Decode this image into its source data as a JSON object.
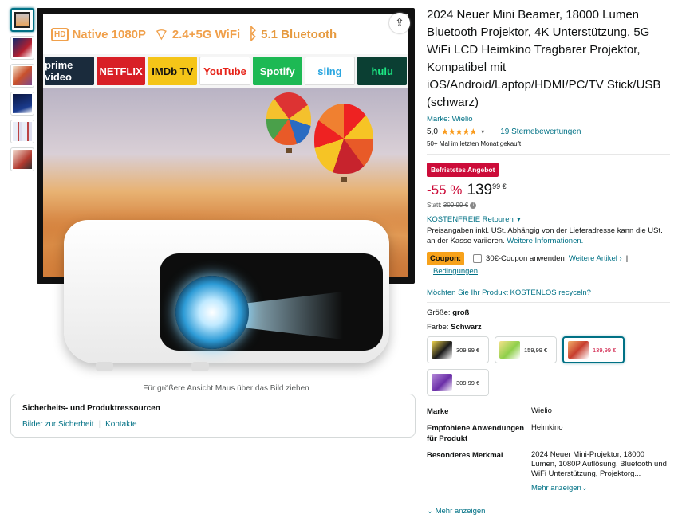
{
  "gallery": {
    "thumbnails": [
      {
        "name": "thumbnail-1",
        "selected": true
      },
      {
        "name": "thumbnail-2",
        "selected": false
      },
      {
        "name": "thumbnail-3",
        "selected": false
      },
      {
        "name": "thumbnail-4",
        "selected": false
      },
      {
        "name": "thumbnail-5",
        "selected": false
      },
      {
        "name": "thumbnail-6",
        "selected": false
      }
    ],
    "hd_badge": "HD",
    "features": {
      "native": "Native 1080P",
      "wifi": "2.4+5G WiFi",
      "bluetooth": "5.1 Bluetooth"
    },
    "apps": [
      {
        "label": "prime video",
        "bg": "#1a2b3c"
      },
      {
        "label": "NETFLIX",
        "bg": "#d81f26"
      },
      {
        "label": "IMDb TV",
        "bg": "#f5c518"
      },
      {
        "label": "YouTube",
        "bg": "#ffffff"
      },
      {
        "label": "Spotify",
        "bg": "#1db954"
      },
      {
        "label": "sling",
        "bg": "#ffffff"
      },
      {
        "label": "hulu",
        "bg": "#0b3f33"
      }
    ],
    "hover_hint": "Für größere Ansicht Maus über das Bild ziehen"
  },
  "safety": {
    "title": "Sicherheits- und Produktressourcen",
    "link1": "Bilder zur Sicherheit",
    "link2": "Kontakte"
  },
  "product": {
    "title": "2024 Neuer Mini Beamer, 18000 Lumen Bluetooth Projektor, 4K Unterstützung, 5G WiFi LCD Heimkino Tragbarer Projektor, Kompatibel mit iOS/Android/Laptop/HDMI/PC/TV Stick/USB (schwarz)",
    "brand_link": "Marke: Wielio",
    "rating": "5,0",
    "stars": "★★★★★",
    "ratings_count": "19 Sternebewertungen",
    "bought": "50+ Mal im letzten Monat gekauft",
    "deal_badge": "Befristetes Angebot",
    "discount": "-55 %",
    "price_whole": "139",
    "price_fraction": "99 €",
    "was_label": "Statt:",
    "was_price": "309,99 €",
    "returns": "KOSTENFREIE Retouren",
    "price_info": "Preisangaben inkl. USt. Abhängig von der Lieferadresse kann die USt. an der Kasse variieren.",
    "price_info_link": "Weitere Informationen.",
    "coupon_tag": "Coupon:",
    "coupon_text": "30€-Coupon anwenden",
    "coupon_more": "Weitere Artikel",
    "coupon_conditions": "Bedingungen",
    "recycle": "Möchten Sie Ihr Produkt KOSTENLOS recyceln?",
    "size_label": "Größe:",
    "size_value": "groß",
    "color_label": "Farbe:",
    "color_value": "Schwarz",
    "variants": [
      {
        "price": "309,99 €",
        "selected": false,
        "img": "linear-gradient(135deg,#f2d64b,#1b1b1b 55%,#fff)"
      },
      {
        "price": "159,99 €",
        "selected": false,
        "img": "linear-gradient(135deg,#f4e28a,#8fcf4a 55%,#fff)"
      },
      {
        "price": "139,99 €",
        "selected": true,
        "img": "linear-gradient(135deg,#f3b06a,#c73d2d 50%,#fff)"
      },
      {
        "price": "309,99 €",
        "selected": false,
        "img": "linear-gradient(135deg,#b58ad9,#6b2fa8 55%,#fff)"
      }
    ]
  },
  "attributes": [
    {
      "key": "Marke",
      "value": "Wielio"
    },
    {
      "key": "Empfohlene Anwendungen für Produkt",
      "value": "Heimkino"
    },
    {
      "key": "Besonderes Merkmal",
      "value": "2024 Neuer Mini-Projektor, 18000 Lumen, 1080P Auflösung, Bluetooth und WiFi Unterstützung, Projektorg..."
    }
  ],
  "attr_more": "Mehr anzeigen",
  "show_more": "Mehr anzeigen",
  "colors": {
    "link": "#007185",
    "deal": "#cc0c39",
    "star": "#f99b1d",
    "coupon": "#f7a21b"
  }
}
